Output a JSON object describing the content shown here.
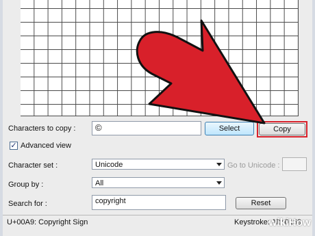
{
  "window": {
    "characters_to_copy_label": "Characters to copy :",
    "characters_to_copy_value": "©",
    "select_label": "Select",
    "copy_label": "Copy",
    "advanced_view_label": "Advanced view",
    "advanced_view_checked": true,
    "character_set_label": "Character set :",
    "character_set_value": "Unicode",
    "go_to_unicode_label": "Go to Unicode :",
    "group_by_label": "Group by :",
    "group_by_value": "All",
    "search_for_label": "Search for :",
    "search_for_value": "copyright",
    "reset_label": "Reset"
  },
  "status_bar": {
    "character_info": "U+00A9: Copyright Sign",
    "keystroke": "Keystroke: Alt+0169"
  },
  "overlay": {
    "arrow_color": "#d8202a",
    "highlight_color": "#d8202a",
    "watermark": "wikiHow"
  },
  "icons": {
    "checkmark": "check-icon",
    "dropdown": "chevron-down-icon",
    "pointer": "red-arrow-icon"
  }
}
